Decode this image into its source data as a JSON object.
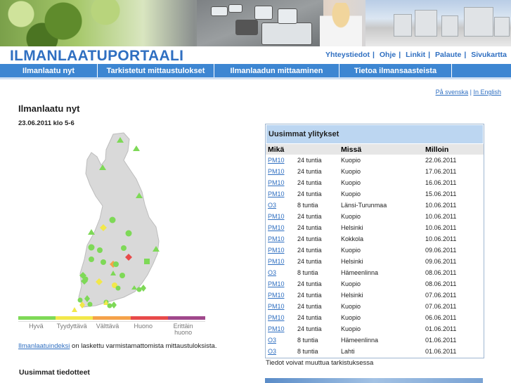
{
  "site": {
    "logo": "ILMANLAATUPORTAALI"
  },
  "toplinks": [
    "Yhteystiedot",
    "Ohje",
    "Linkit",
    "Palaute",
    "Sivukartta"
  ],
  "nav": [
    {
      "label": "Ilmanlaatu nyt"
    },
    {
      "label": "Tarkistetut mittaustulokset"
    },
    {
      "label": "Ilmanlaadun mittaaminen"
    },
    {
      "label": "Tietoa ilmansaasteista"
    }
  ],
  "lang": {
    "swedish": "På svenska",
    "english": "In English"
  },
  "main": {
    "title": "Ilmanlaatu nyt",
    "date": "23.06.2011 klo 5-6",
    "note_link": "Ilmanlaatuindeksi",
    "note_text": " on laskettu varmistamattomista mittaustuloksista.",
    "bulletins_title": "Uusimmat tiedotteet"
  },
  "legend": [
    {
      "label": "Hyvä",
      "color": "#7ed957"
    },
    {
      "label": "Tyydyttävä",
      "color": "#f2e84a"
    },
    {
      "label": "Välttävä",
      "color": "#f5a24a"
    },
    {
      "label": "Huono",
      "color": "#e84a4a"
    },
    {
      "label": "Erittäin huono",
      "color": "#a0488c"
    }
  ],
  "exceedances": {
    "title": "Uusimmat ylitykset",
    "columns": [
      "Mikä",
      "",
      "Missä",
      "Milloin"
    ],
    "rows": [
      [
        "PM10",
        "24 tuntia",
        "Kuopio",
        "22.06.2011"
      ],
      [
        "PM10",
        "24 tuntia",
        "Kuopio",
        "17.06.2011"
      ],
      [
        "PM10",
        "24 tuntia",
        "Kuopio",
        "16.06.2011"
      ],
      [
        "PM10",
        "24 tuntia",
        "Kuopio",
        "15.06.2011"
      ],
      [
        "O3",
        "8 tuntia",
        "Länsi-Turunmaa",
        "10.06.2011"
      ],
      [
        "PM10",
        "24 tuntia",
        "Kuopio",
        "10.06.2011"
      ],
      [
        "PM10",
        "24 tuntia",
        "Helsinki",
        "10.06.2011"
      ],
      [
        "PM10",
        "24 tuntia",
        "Kokkola",
        "10.06.2011"
      ],
      [
        "PM10",
        "24 tuntia",
        "Kuopio",
        "09.06.2011"
      ],
      [
        "PM10",
        "24 tuntia",
        "Helsinki",
        "09.06.2011"
      ],
      [
        "O3",
        "8 tuntia",
        "Hämeenlinna",
        "08.06.2011"
      ],
      [
        "PM10",
        "24 tuntia",
        "Kuopio",
        "08.06.2011"
      ],
      [
        "PM10",
        "24 tuntia",
        "Helsinki",
        "07.06.2011"
      ],
      [
        "PM10",
        "24 tuntia",
        "Kuopio",
        "07.06.2011"
      ],
      [
        "PM10",
        "24 tuntia",
        "Kuopio",
        "06.06.2011"
      ],
      [
        "PM10",
        "24 tuntia",
        "Kuopio",
        "01.06.2011"
      ],
      [
        "O3",
        "8 tuntia",
        "Hämeenlinna",
        "01.06.2011"
      ],
      [
        "O3",
        "8 tuntia",
        "Lahti",
        "01.06.2011"
      ]
    ],
    "note": "Tiedot voivat muuttua tarkistuksessa"
  }
}
